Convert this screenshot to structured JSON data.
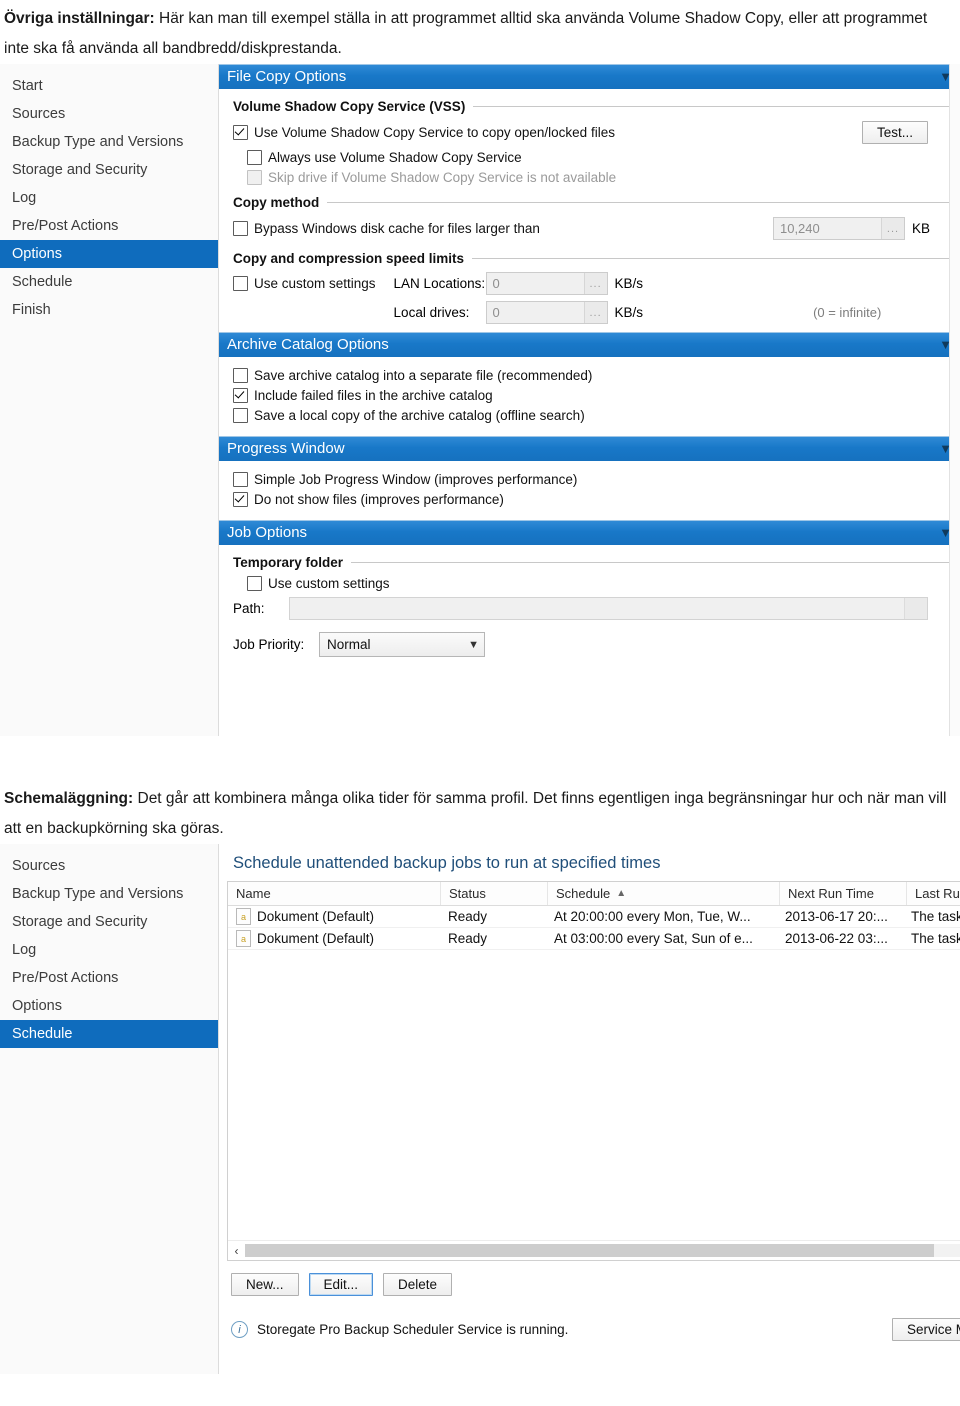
{
  "intro": {
    "lead": "Övriga inställningar:",
    "body": " Här kan man till exempel ställa in att programmet alltid ska använda Volume Shadow Copy, eller att programmet inte ska få använda all bandbredd/diskprestanda."
  },
  "schedule_intro": {
    "lead": "Schemaläggning:",
    "body": " Det går att kombinera många olika tider för samma profil. Det finns egentligen inga begränsningar hur och när man vill att en backupkörning ska göras."
  },
  "colors": {
    "header_blue": "#1878c8",
    "select_blue": "#0f6cbd",
    "title_blue": "#1f4e79"
  },
  "options_window": {
    "sidebar": {
      "items": [
        {
          "label": "Start",
          "selected": false
        },
        {
          "label": "Sources",
          "selected": false
        },
        {
          "label": "Backup Type and Versions",
          "selected": false
        },
        {
          "label": "Storage and Security",
          "selected": false
        },
        {
          "label": "Log",
          "selected": false
        },
        {
          "label": "Pre/Post Actions",
          "selected": false
        },
        {
          "label": "Options",
          "selected": true
        },
        {
          "label": "Schedule",
          "selected": false
        },
        {
          "label": "Finish",
          "selected": false
        }
      ]
    },
    "file_copy": {
      "title": "File Copy Options",
      "collapse_icon": "chevron-down-icon",
      "vss_group": "Volume Shadow Copy Service (VSS)",
      "cb_use_vss": {
        "label": "Use Volume Shadow Copy Service to copy open/locked files",
        "checked": true
      },
      "cb_always_vss": {
        "label": "Always use Volume Shadow Copy Service",
        "checked": false
      },
      "cb_skip_drive": {
        "label": "Skip drive if Volume Shadow Copy Service is not available",
        "checked": false,
        "disabled": true
      },
      "test_button": "Test...",
      "copy_method_group": "Copy method",
      "cb_bypass": {
        "label": "Bypass Windows disk cache for files larger than",
        "checked": false
      },
      "bypass_value": "10,240",
      "bypass_unit": "KB",
      "speed_group": "Copy and compression speed limits",
      "cb_custom_speed": {
        "label": "Use custom settings",
        "checked": false
      },
      "lan_label": "LAN Locations:",
      "lan_value": "0",
      "local_label": "Local drives:",
      "local_value": "0",
      "speed_unit": "KB/s",
      "infinite_note": "(0 = infinite)",
      "browse_glyph": "..."
    },
    "archive_catalog": {
      "title": "Archive Catalog Options",
      "collapse_icon": "chevron-down-icon",
      "cb_separate_file": {
        "label": "Save archive catalog into a separate file (recommended)",
        "checked": false
      },
      "cb_failed_files": {
        "label": "Include failed files in the archive catalog",
        "checked": true
      },
      "cb_local_copy": {
        "label": "Save a local copy of the archive catalog (offline search)",
        "checked": false
      }
    },
    "progress_window": {
      "title": "Progress Window",
      "collapse_icon": "chevron-down-icon",
      "cb_simple": {
        "label": "Simple Job Progress Window (improves performance)",
        "checked": false
      },
      "cb_no_files": {
        "label": "Do not show files (improves performance)",
        "checked": true
      }
    },
    "job_options": {
      "title": "Job Options",
      "collapse_icon": "chevron-down-icon",
      "temp_group": "Temporary folder",
      "cb_custom": {
        "label": "Use custom settings",
        "checked": false
      },
      "path_label": "Path:",
      "path_value": "",
      "priority_label": "Job Priority:",
      "priority_value": "Normal"
    }
  },
  "schedule_window": {
    "sidebar": {
      "items": [
        {
          "label": "Sources",
          "selected": false
        },
        {
          "label": "Backup Type and Versions",
          "selected": false
        },
        {
          "label": "Storage and Security",
          "selected": false
        },
        {
          "label": "Log",
          "selected": false
        },
        {
          "label": "Pre/Post Actions",
          "selected": false
        },
        {
          "label": "Options",
          "selected": false
        },
        {
          "label": "Schedule",
          "selected": true
        }
      ]
    },
    "title": "Schedule unattended backup jobs to run at specified times",
    "columns": [
      "Name",
      "Status",
      "Schedule",
      "Next Run Time",
      "Last Run Time"
    ],
    "sorted_column": "Schedule",
    "sort_caret": "▲",
    "rows": [
      {
        "name": "Dokument (Default)",
        "status": "Ready",
        "schedule": "At 20:00:00 every Mon, Tue, W...",
        "next_run": "2013-06-17 20:...",
        "last_run": "The task has"
      },
      {
        "name": "Dokument (Default)",
        "status": "Ready",
        "schedule": "At 03:00:00 every Sat, Sun of e...",
        "next_run": "2013-06-22 03:...",
        "last_run": "The task has"
      }
    ],
    "scroll_left": "‹",
    "scroll_right": "›",
    "buttons": {
      "new": "New...",
      "edit": "Edit...",
      "delete": "Delete",
      "service_manager": "Service Manager"
    },
    "status_text": "Storegate Pro Backup Scheduler Service is running."
  }
}
